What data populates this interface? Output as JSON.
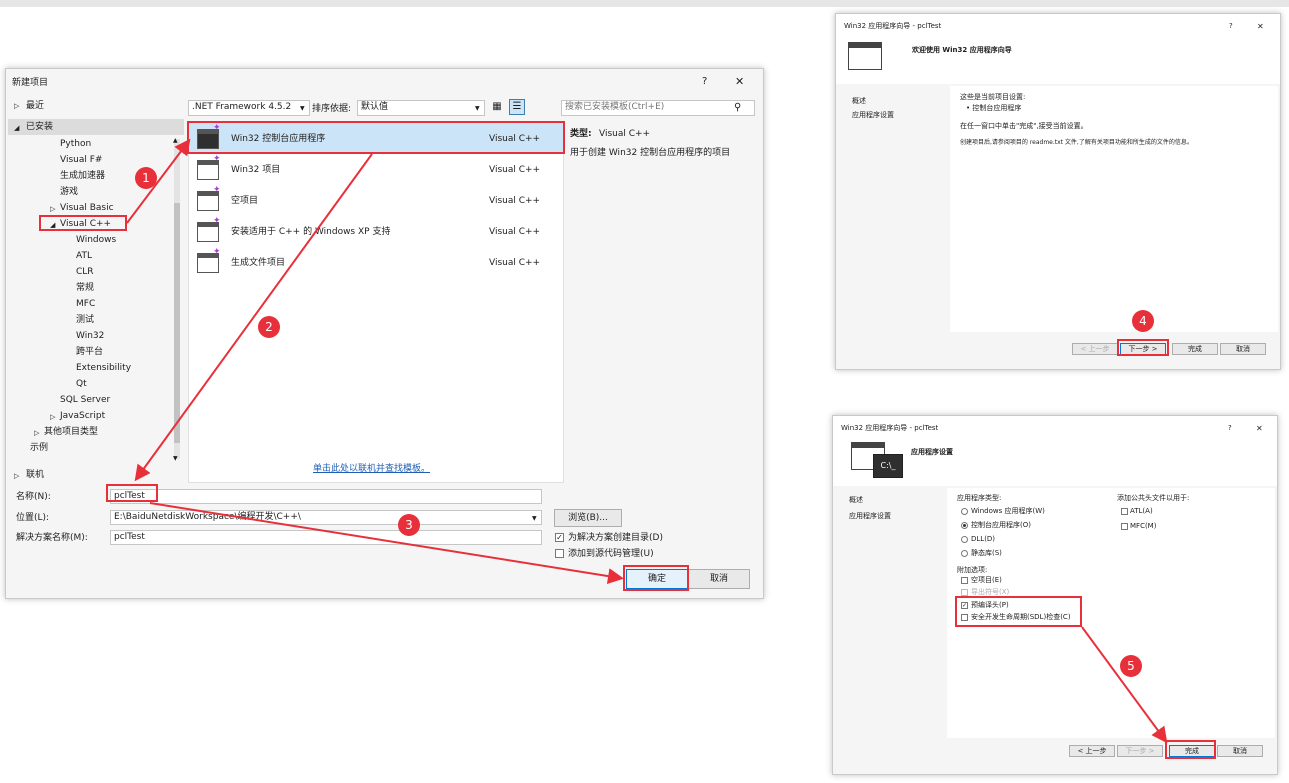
{
  "new_project": {
    "title": "新建项目",
    "help": "?",
    "close": "✕",
    "tree": {
      "recent": "最近",
      "installed": "已安装",
      "python": "Python",
      "fsharp": "Visual F#",
      "generator": "生成加速器",
      "games": "游戏",
      "vb": "Visual Basic",
      "vcpp": "Visual C++",
      "vcpp_children": [
        "Windows",
        "ATL",
        "CLR",
        "常规",
        "MFC",
        "测试",
        "Win32",
        "跨平台",
        "Extensibility",
        "Qt"
      ],
      "sql": "SQL Server",
      "js": "JavaScript",
      "other_types": "其他项目类型",
      "samples": "示例",
      "online": "联机"
    },
    "framework": ".NET Framework 4.5.2",
    "sort_label": "排序依据:",
    "sort_value": "默认值",
    "search_placeholder": "搜索已安装模板(Ctrl+E)",
    "templates": [
      {
        "name": "Win32 控制台应用程序",
        "lang": "Visual C++"
      },
      {
        "name": "Win32 项目",
        "lang": "Visual C++"
      },
      {
        "name": "空项目",
        "lang": "Visual C++"
      },
      {
        "name": "安装适用于 C++ 的 Windows XP 支持",
        "lang": "Visual C++"
      },
      {
        "name": "生成文件项目",
        "lang": "Visual C++"
      }
    ],
    "type_label": "类型:",
    "type_value": "Visual C++",
    "type_desc": "用于创建 Win32 控制台应用程序的项目",
    "online_link": "单击此处以联机并查找模板。",
    "name_label": "名称(N):",
    "name_value": "pclTest",
    "location_label": "位置(L):",
    "location_value": "E:\\BaiduNetdiskWorkspace\\编程开发\\C++\\",
    "solution_label": "解决方案名称(M):",
    "solution_value": "pclTest",
    "browse": "浏览(B)...",
    "create_dir": "为解决方案创建目录(D)",
    "add_source_control": "添加到源代码管理(U)",
    "ok": "确定",
    "cancel": "取消"
  },
  "wizard1": {
    "title": "Win32 应用程序向导 - pclTest",
    "help": "?",
    "close": "✕",
    "heading": "欢迎使用 Win32 应用程序向导",
    "nav": [
      "概述",
      "应用程序设置"
    ],
    "text1": "这些是当前项目设置:",
    "text2": "• 控制台应用程序",
    "text3": "在任一窗口中单击\"完成\",接受当前设置。",
    "text4": "创建项目后,请参阅项目的 readme.txt 文件,了解有关项目功能和所生成的文件的信息。",
    "prev": "< 上一步",
    "next": "下一步 >",
    "finish": "完成",
    "cancel": "取消"
  },
  "wizard2": {
    "title": "Win32 应用程序向导 - pclTest",
    "help": "?",
    "close": "✕",
    "heading": "应用程序设置",
    "icon_text": "C:\\_",
    "nav": [
      "概述",
      "应用程序设置"
    ],
    "app_type_label": "应用程序类型:",
    "app_types": [
      "Windows 应用程序(W)",
      "控制台应用程序(O)",
      "DLL(D)",
      "静态库(S)"
    ],
    "headers_label": "添加公共头文件以用于:",
    "headers": [
      "ATL(A)",
      "MFC(M)"
    ],
    "extra_label": "附加选项:",
    "extra_empty": "空项目(E)",
    "extra_export": "导出符号(X)",
    "extra_pch": "预编译头(P)",
    "extra_sdl": "安全开发生命周期(SDL)检查(C)",
    "prev": "< 上一步",
    "next": "下一步 >",
    "finish": "完成",
    "cancel": "取消"
  },
  "badges": [
    "1",
    "2",
    "3",
    "4",
    "5"
  ],
  "colors": {
    "annotation_red": "#e8303a",
    "selection": "#cce4f7",
    "link": "#1e5fb4"
  }
}
